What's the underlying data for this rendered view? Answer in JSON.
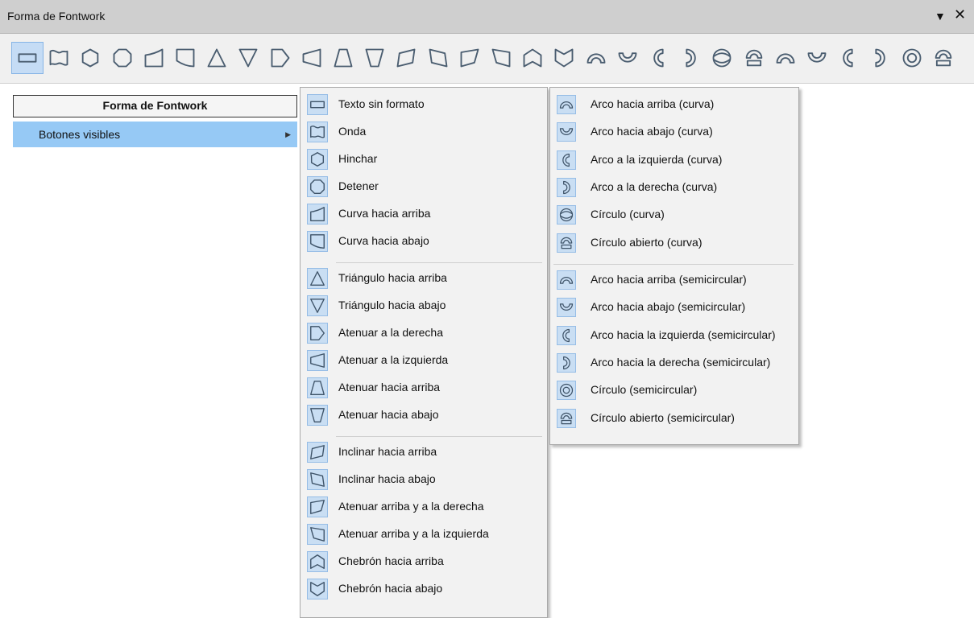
{
  "window": {
    "title": "Forma de Fontwork",
    "menu_arrow": "▼",
    "close": "✕"
  },
  "toolbar": {
    "buttons": [
      {
        "name": "plain-text",
        "icon": "rect"
      },
      {
        "name": "wave",
        "icon": "wave"
      },
      {
        "name": "inflate",
        "icon": "hexagon"
      },
      {
        "name": "stop",
        "icon": "octagon"
      },
      {
        "name": "curve-up",
        "icon": "curve-up"
      },
      {
        "name": "curve-down",
        "icon": "curve-down"
      },
      {
        "name": "triangle-up",
        "icon": "triangle-up"
      },
      {
        "name": "triangle-down",
        "icon": "triangle-down"
      },
      {
        "name": "fade-right",
        "icon": "fade-right"
      },
      {
        "name": "fade-left",
        "icon": "fade-left"
      },
      {
        "name": "fade-up",
        "icon": "fade-up"
      },
      {
        "name": "fade-down",
        "icon": "fade-down"
      },
      {
        "name": "slant-up",
        "icon": "slant-up"
      },
      {
        "name": "slant-down",
        "icon": "slant-down"
      },
      {
        "name": "fade-up-right",
        "icon": "fade-up-right"
      },
      {
        "name": "fade-up-left",
        "icon": "fade-up-left"
      },
      {
        "name": "chevron-up",
        "icon": "chevron-up"
      },
      {
        "name": "chevron-down",
        "icon": "chevron-down"
      },
      {
        "name": "arch-up-curve",
        "icon": "arch-up"
      },
      {
        "name": "arch-down-curve",
        "icon": "arch-down"
      },
      {
        "name": "arch-left-curve",
        "icon": "arch-left"
      },
      {
        "name": "arch-right-curve",
        "icon": "arch-right"
      },
      {
        "name": "circle-curve",
        "icon": "circle-curve"
      },
      {
        "name": "open-circle-curve",
        "icon": "open-circle"
      },
      {
        "name": "arch-up-pour",
        "icon": "arch-up"
      },
      {
        "name": "arch-down-pour",
        "icon": "arch-down"
      },
      {
        "name": "arch-left-pour",
        "icon": "arch-left"
      },
      {
        "name": "arch-right-pour",
        "icon": "arch-right"
      },
      {
        "name": "circle-pour",
        "icon": "circle-pour"
      },
      {
        "name": "open-circle-pour",
        "icon": "open-circle"
      }
    ]
  },
  "context_menu": {
    "header": "Forma de Fontwork",
    "item": "Botones visibles"
  },
  "menu1": {
    "items": [
      {
        "label": "Texto sin formato",
        "icon": "rect"
      },
      {
        "label": "Onda",
        "icon": "wave"
      },
      {
        "label": "Hinchar",
        "icon": "hexagon"
      },
      {
        "label": "Detener",
        "icon": "octagon"
      },
      {
        "label": "Curva hacia arriba",
        "icon": "curve-up"
      },
      {
        "label": "Curva hacia abajo",
        "icon": "curve-down"
      },
      {
        "label": "Triángulo hacia arriba",
        "icon": "triangle-up"
      },
      {
        "label": "Triángulo hacia abajo",
        "icon": "triangle-down"
      },
      {
        "label": "Atenuar a la derecha",
        "icon": "fade-right"
      },
      {
        "label": "Atenuar a la izquierda",
        "icon": "fade-left"
      },
      {
        "label": "Atenuar hacia arriba",
        "icon": "fade-up"
      },
      {
        "label": "Atenuar hacia abajo",
        "icon": "fade-down"
      },
      {
        "label": "Inclinar hacia arriba",
        "icon": "slant-up"
      },
      {
        "label": "Inclinar hacia abajo",
        "icon": "slant-down"
      },
      {
        "label": "Atenuar arriba y a la derecha",
        "icon": "fade-up-right"
      },
      {
        "label": "Atenuar arriba y a la izquierda",
        "icon": "fade-up-left"
      },
      {
        "label": "Chebrón hacia arriba",
        "icon": "chevron-up"
      },
      {
        "label": "Chebrón hacia abajo",
        "icon": "chevron-down"
      }
    ]
  },
  "menu2": {
    "items": [
      {
        "label": "Arco hacia arriba (curva)",
        "icon": "arch-up"
      },
      {
        "label": "Arco hacia abajo (curva)",
        "icon": "arch-down"
      },
      {
        "label": "Arco a la izquierda (curva)",
        "icon": "arch-left"
      },
      {
        "label": "Arco a la derecha (curva)",
        "icon": "arch-right"
      },
      {
        "label": "Círculo (curva)",
        "icon": "circle-curve"
      },
      {
        "label": "Círculo abierto (curva)",
        "icon": "open-circle"
      },
      {
        "label": "Arco hacia arriba (semicircular)",
        "icon": "arch-up"
      },
      {
        "label": "Arco hacia abajo (semicircular)",
        "icon": "arch-down"
      },
      {
        "label": "Arco hacia la izquierda (semicircular)",
        "icon": "arch-left"
      },
      {
        "label": "Arco hacia la derecha (semicircular)",
        "icon": "arch-right"
      },
      {
        "label": "Círculo (semicircular)",
        "icon": "circle-pour"
      },
      {
        "label": "Círculo abierto (semicircular)",
        "icon": "open-circle"
      }
    ]
  },
  "colors": {
    "highlight": "#96c9f5",
    "icon_bg": "#c9def3",
    "titlebar": "#cfcfcf"
  }
}
